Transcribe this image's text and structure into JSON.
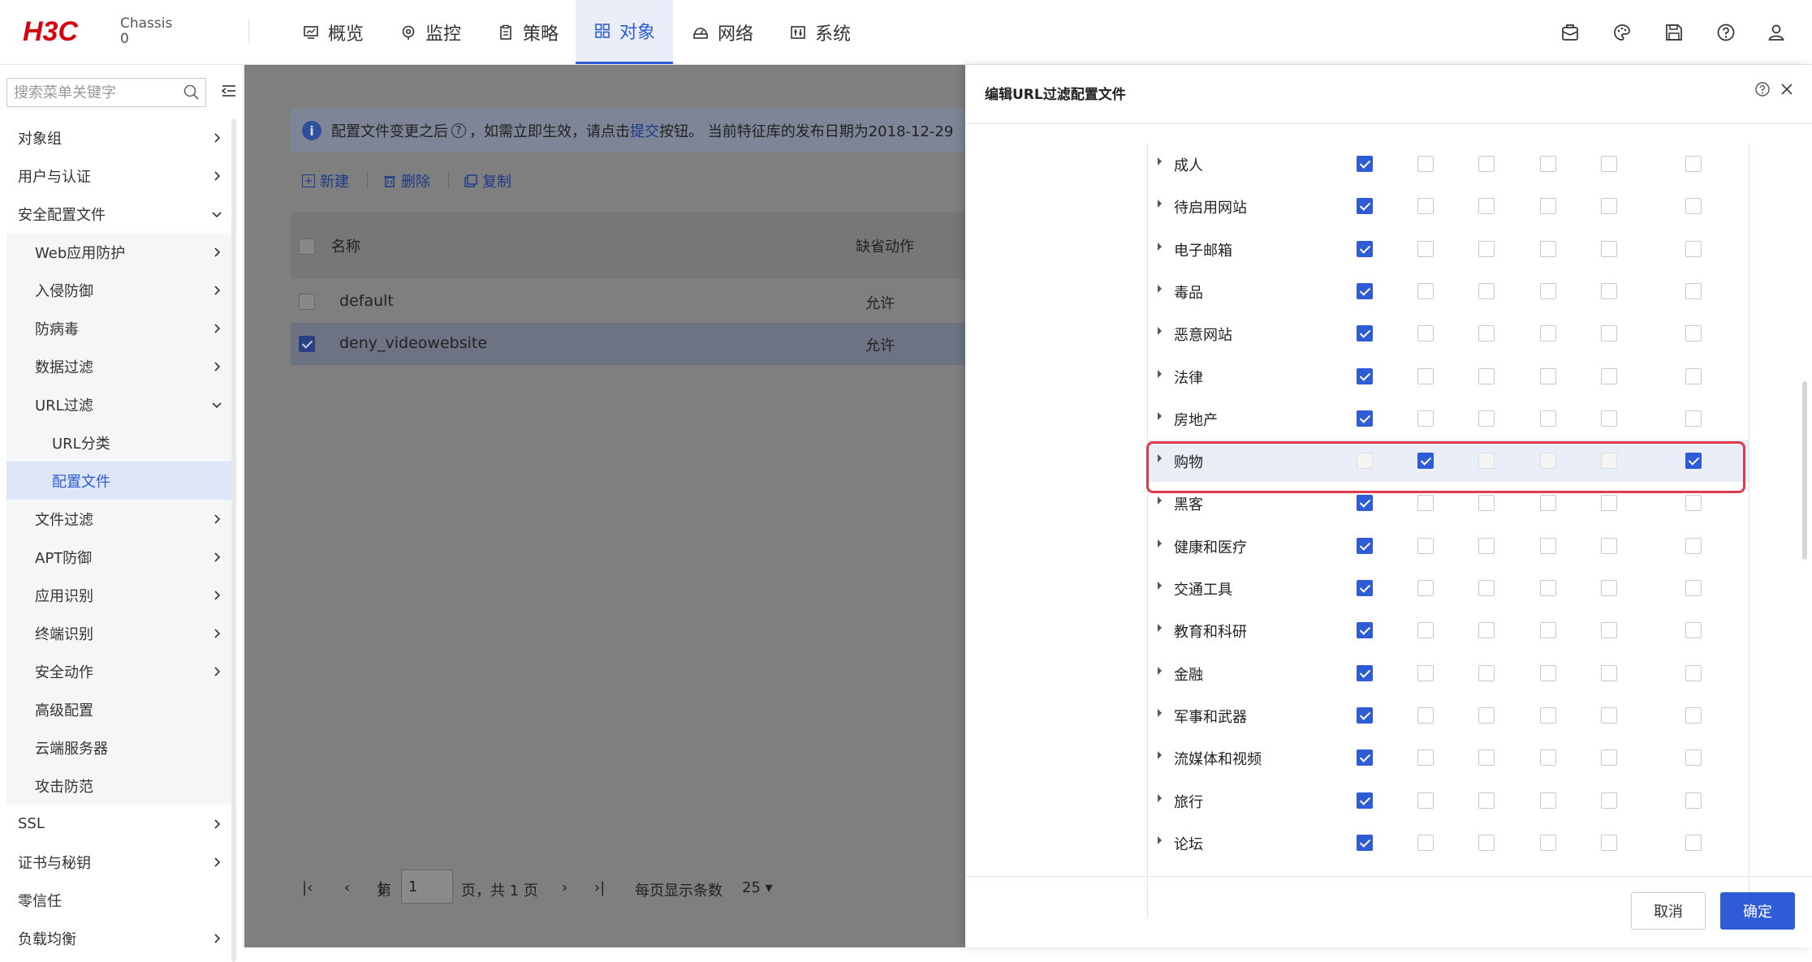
{
  "header": {
    "logo_text": "H3C",
    "chassis_label": "Chassis",
    "chassis_value": "0",
    "tabs": [
      {
        "label": "概览",
        "icon": "dashboard-icon"
      },
      {
        "label": "监控",
        "icon": "monitor-icon"
      },
      {
        "label": "策略",
        "icon": "policy-icon"
      },
      {
        "label": "对象",
        "icon": "object-icon",
        "active": true
      },
      {
        "label": "网络",
        "icon": "network-icon"
      },
      {
        "label": "系统",
        "icon": "system-icon"
      }
    ],
    "right_icons": [
      "save-config-icon",
      "theme-icon",
      "disk-save-icon",
      "help-icon",
      "user-icon"
    ]
  },
  "sidebar": {
    "search_placeholder": "搜索菜单关键字",
    "items": [
      {
        "label": "对象组",
        "level": 0,
        "arrow": "right"
      },
      {
        "label": "用户与认证",
        "level": 0,
        "arrow": "right"
      },
      {
        "label": "安全配置文件",
        "level": 0,
        "arrow": "down"
      },
      {
        "label": "Web应用防护",
        "level": 1,
        "arrow": "right"
      },
      {
        "label": "入侵防御",
        "level": 1,
        "arrow": "right"
      },
      {
        "label": "防病毒",
        "level": 1,
        "arrow": "right"
      },
      {
        "label": "数据过滤",
        "level": 1,
        "arrow": "right"
      },
      {
        "label": "URL过滤",
        "level": 1,
        "arrow": "down"
      },
      {
        "label": "URL分类",
        "level": 2,
        "arrow": ""
      },
      {
        "label": "配置文件",
        "level": 2,
        "arrow": "",
        "selected": true
      },
      {
        "label": "文件过滤",
        "level": 1,
        "arrow": "right"
      },
      {
        "label": "APT防御",
        "level": 1,
        "arrow": "right"
      },
      {
        "label": "应用识别",
        "level": 1,
        "arrow": "right"
      },
      {
        "label": "终端识别",
        "level": 1,
        "arrow": "right"
      },
      {
        "label": "安全动作",
        "level": 1,
        "arrow": "right"
      },
      {
        "label": "高级配置",
        "level": 1,
        "arrow": ""
      },
      {
        "label": "云端服务器",
        "level": 1,
        "arrow": ""
      },
      {
        "label": "攻击防范",
        "level": 1,
        "arrow": ""
      },
      {
        "label": "SSL",
        "level": 0,
        "arrow": "right"
      },
      {
        "label": "证书与秘钥",
        "level": 0,
        "arrow": "right"
      },
      {
        "label": "零信任",
        "level": 0,
        "arrow": ""
      },
      {
        "label": "负载均衡",
        "level": 0,
        "arrow": "right"
      }
    ]
  },
  "main": {
    "notice_pre": "配置文件变更之后",
    "notice_mid": "，如需立即生效，请点击",
    "notice_link": "提交",
    "notice_post": "按钮。  当前特征库的发布日期为2018-12-29",
    "toolbar": {
      "new_label": "新建",
      "delete_label": "删除",
      "copy_label": "复制"
    },
    "table": {
      "col_name": "名称",
      "col_action": "缺省动作",
      "rows": [
        {
          "name": "default",
          "action": "允许",
          "checked": false
        },
        {
          "name": "deny_videowebsite",
          "action": "允许",
          "checked": true
        }
      ]
    },
    "pager": {
      "page_prefix": "第",
      "page_value": "1",
      "page_suffix": "页，共 1 页",
      "per_page_label": "每页显示条数",
      "per_page_value": "25"
    }
  },
  "drawer": {
    "title": "编辑URL过滤配置文件",
    "cancel_label": "取消",
    "ok_label": "确定",
    "categories": [
      {
        "name": "成人",
        "checks": [
          "on",
          "off",
          "off",
          "off",
          "off",
          "off"
        ]
      },
      {
        "name": "待启用网站",
        "checks": [
          "on",
          "off",
          "off",
          "off",
          "off",
          "off"
        ]
      },
      {
        "name": "电子邮箱",
        "checks": [
          "on",
          "off",
          "off",
          "off",
          "off",
          "off"
        ]
      },
      {
        "name": "毒品",
        "checks": [
          "on",
          "off",
          "off",
          "off",
          "off",
          "off"
        ]
      },
      {
        "name": "恶意网站",
        "checks": [
          "on",
          "off",
          "off",
          "off",
          "off",
          "off"
        ]
      },
      {
        "name": "法律",
        "checks": [
          "on",
          "off",
          "off",
          "off",
          "off",
          "off"
        ]
      },
      {
        "name": "房地产",
        "checks": [
          "on",
          "off",
          "off",
          "off",
          "off",
          "off"
        ]
      },
      {
        "name": "购物",
        "checks": [
          "dis",
          "on",
          "dis",
          "dis",
          "dis",
          "on"
        ],
        "highlighted": true
      },
      {
        "name": "黑客",
        "checks": [
          "on",
          "off",
          "off",
          "off",
          "off",
          "off"
        ]
      },
      {
        "name": "健康和医疗",
        "checks": [
          "on",
          "off",
          "off",
          "off",
          "off",
          "off"
        ]
      },
      {
        "name": "交通工具",
        "checks": [
          "on",
          "off",
          "off",
          "off",
          "off",
          "off"
        ]
      },
      {
        "name": "教育和科研",
        "checks": [
          "on",
          "off",
          "off",
          "off",
          "off",
          "off"
        ]
      },
      {
        "name": "金融",
        "checks": [
          "on",
          "off",
          "off",
          "off",
          "off",
          "off"
        ]
      },
      {
        "name": "军事和武器",
        "checks": [
          "on",
          "off",
          "off",
          "off",
          "off",
          "off"
        ]
      },
      {
        "name": "流媒体和视频",
        "checks": [
          "on",
          "off",
          "off",
          "off",
          "off",
          "off"
        ]
      },
      {
        "name": "旅行",
        "checks": [
          "on",
          "off",
          "off",
          "off",
          "off",
          "off"
        ]
      },
      {
        "name": "论坛",
        "checks": [
          "on",
          "off",
          "off",
          "off",
          "off",
          "off"
        ]
      }
    ]
  },
  "colors": {
    "accent": "#2e5bd6",
    "highlight_border": "#e03a4e",
    "brand_red": "#d7000f"
  }
}
